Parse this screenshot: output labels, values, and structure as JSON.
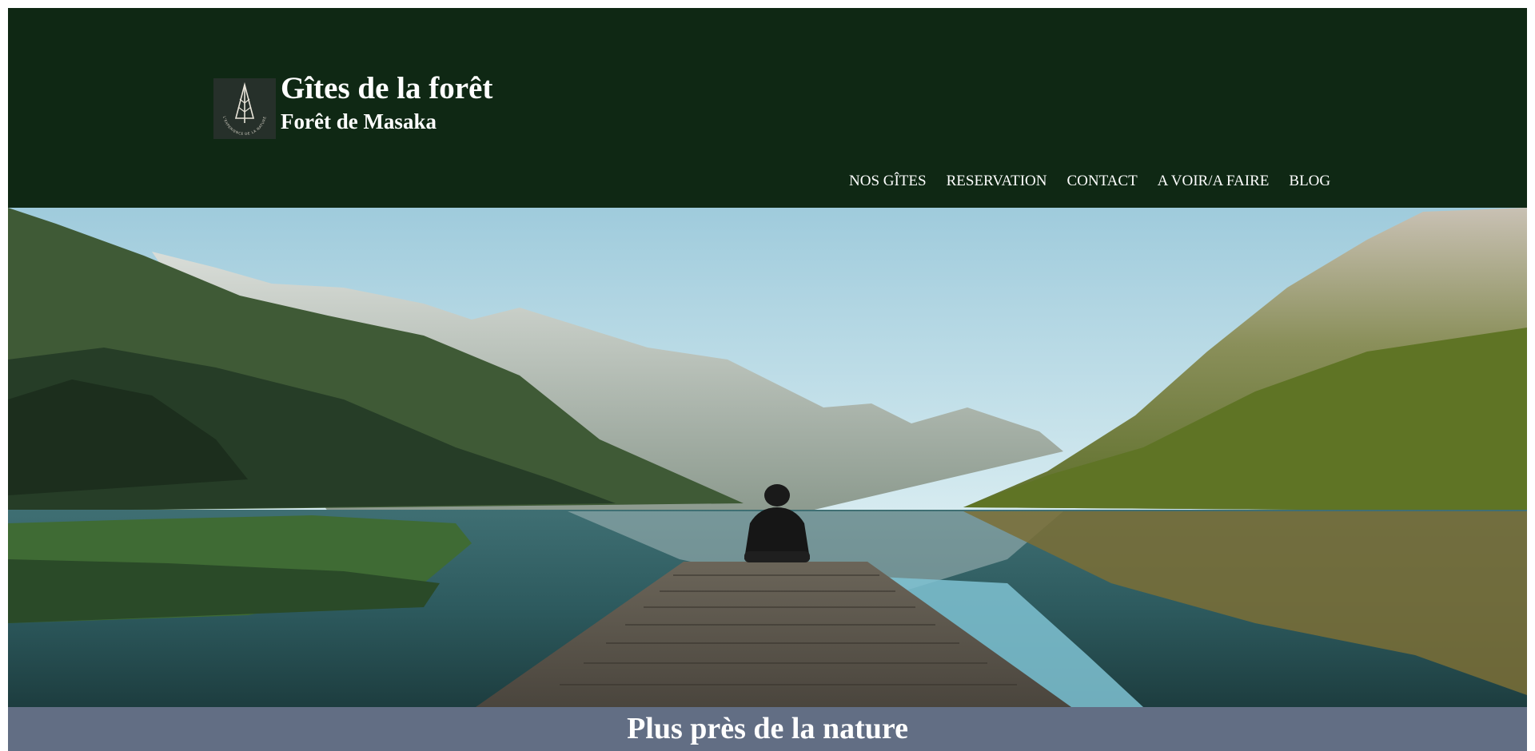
{
  "header": {
    "logo_icon": "tree-logo-icon",
    "logo_caption": "L'EXPERIENCE DE LA NATURE",
    "site_title": "Gîtes de la forêt",
    "site_subtitle": "Forêt de Masaka",
    "background": "#0f2814"
  },
  "nav": {
    "items": [
      {
        "label": "NOS GÎTES"
      },
      {
        "label": "RESERVATION"
      },
      {
        "label": "CONTACT"
      },
      {
        "label": "A VOIR/A FAIRE"
      },
      {
        "label": "BLOG"
      }
    ]
  },
  "hero": {
    "image_subject": "person sitting on wooden pier over mountain lake"
  },
  "banner": {
    "title": "Plus près de la nature",
    "background": "#626e84"
  }
}
